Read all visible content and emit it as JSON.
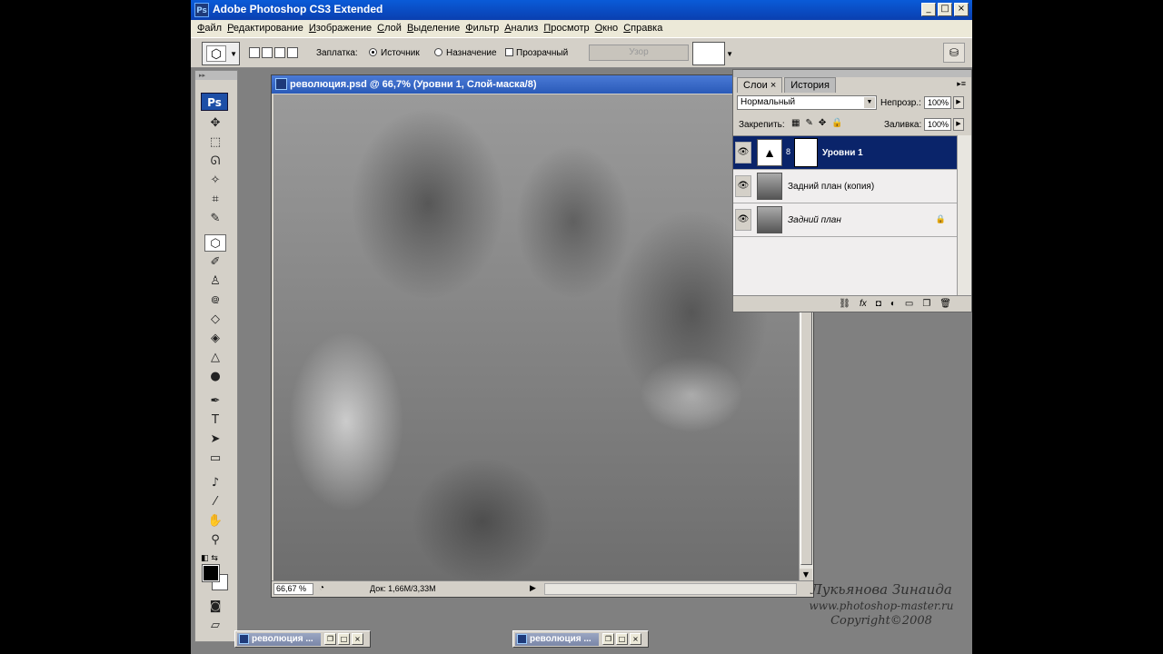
{
  "app": {
    "icon": "Ps",
    "title": "Adobe Photoshop CS3 Extended",
    "min": "_",
    "max": "□",
    "close": "×"
  },
  "menu": [
    "Файл",
    "Редактирование",
    "Изображение",
    "Слой",
    "Выделение",
    "Фильтр",
    "Анализ",
    "Просмотр",
    "Окно",
    "Справка"
  ],
  "options": {
    "patch_label": "Заплатка:",
    "source_label": "Источник",
    "destination_label": "Назначение",
    "transparent_label": "Прозрачный",
    "pattern_label": "Узор",
    "source_selected": true
  },
  "toolbox": {
    "logo": "Ps",
    "tools": [
      "move",
      "marquee",
      "lasso",
      "magic-wand",
      "crop",
      "slice",
      "healing",
      "brush",
      "stamp",
      "history-brush",
      "eraser",
      "gradient",
      "blur",
      "dodge",
      "pen",
      "type",
      "path-select",
      "shape",
      "notes",
      "eyedropper",
      "hand",
      "zoom"
    ],
    "foreground_color": "#000000",
    "background_color": "#ffffff"
  },
  "document": {
    "title": "революция.psd @ 66,7% (Уровни 1, Слой-маска/8)",
    "zoom": "66,67 %",
    "doc_info": "Док: 1,66M/3,33M"
  },
  "layers_panel": {
    "tab_layers": "Слои",
    "tab_history": "История",
    "blend_mode": "Нормальный",
    "opacity_label": "Непрозр.:",
    "opacity": "100%",
    "lock_label": "Закрепить:",
    "fill_label": "Заливка:",
    "fill": "100%",
    "layers": [
      {
        "name": "Уровни 1",
        "selected": true,
        "type": "adjustment"
      },
      {
        "name": "Задний план (копия)",
        "selected": false,
        "type": "image"
      },
      {
        "name": "Задний план",
        "selected": false,
        "type": "image",
        "locked": true
      }
    ],
    "bottom_icons": [
      "link-icon",
      "fx-icon",
      "mask-icon",
      "adjustment-icon",
      "folder-icon",
      "new-layer-icon",
      "trash-icon"
    ]
  },
  "minimized": [
    {
      "title": "революция ..."
    },
    {
      "title": "революция ..."
    }
  ],
  "watermark": {
    "author": "Лукьянова Зинаида",
    "site": "www.photoshop-master.ru",
    "copyright": "Copyright©2008"
  }
}
